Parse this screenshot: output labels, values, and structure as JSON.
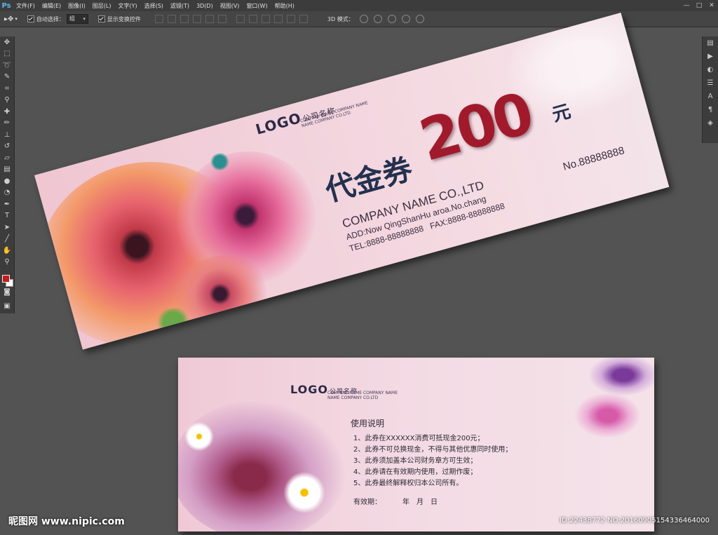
{
  "app": {
    "logo": "Ps",
    "menu": [
      "文件(F)",
      "编辑(E)",
      "图像(I)",
      "图层(L)",
      "文字(Y)",
      "选择(S)",
      "滤镜(T)",
      "3D(D)",
      "视图(V)",
      "窗口(W)",
      "帮助(H)"
    ],
    "window_controls": [
      "—",
      "□",
      "✕"
    ]
  },
  "options_bar": {
    "auto_select_label": "自动选择：",
    "auto_select_value": "组",
    "show_transform_label": "显示变换控件",
    "mode_3d_label": "3D 模式："
  },
  "voucher_front": {
    "logo": "LOGO",
    "company_cn": "公司名称",
    "company_small_1": "COMPANY NAME COMPANY NAME",
    "company_small_2": "NAME COMPANY CO.LTD",
    "title": "代金券",
    "amount": "200",
    "unit": "元",
    "number": "No.88888888",
    "company_en": "COMPANY NAME CO.,LTD",
    "address": "ADD:Now QingShanHu aroa.No.chang",
    "tel": "TEL:8888-88888888",
    "fax": "FAX:8888-88888888"
  },
  "voucher_back": {
    "logo": "LOGO",
    "company_cn": "公司名称",
    "company_small_1": "COMPANY NAME COMPANY NAME",
    "company_small_2": "NAME COMPANY CO.LTD",
    "rules_title": "使用说明",
    "rules": [
      "1、此券在XXXXXX消费可抵现金200元；",
      "2、此券不可兑换现金，不得与其他优惠同时使用；",
      "3、此券须加盖本公司财务章方可生效；",
      "4、此券请在有效期内使用，过期作废；",
      "5、此券最终解释权归本公司所有。"
    ],
    "validity_label": "有效期：",
    "validity_fields": "年　月　日"
  },
  "watermark": {
    "site": "昵图网 www.nipic.com",
    "id": "ID:22438772 NO:20160905154336464000"
  },
  "colors": {
    "amount": "#a01a2c",
    "title": "#23314f",
    "foreground_swatch": "#c21c1c"
  }
}
